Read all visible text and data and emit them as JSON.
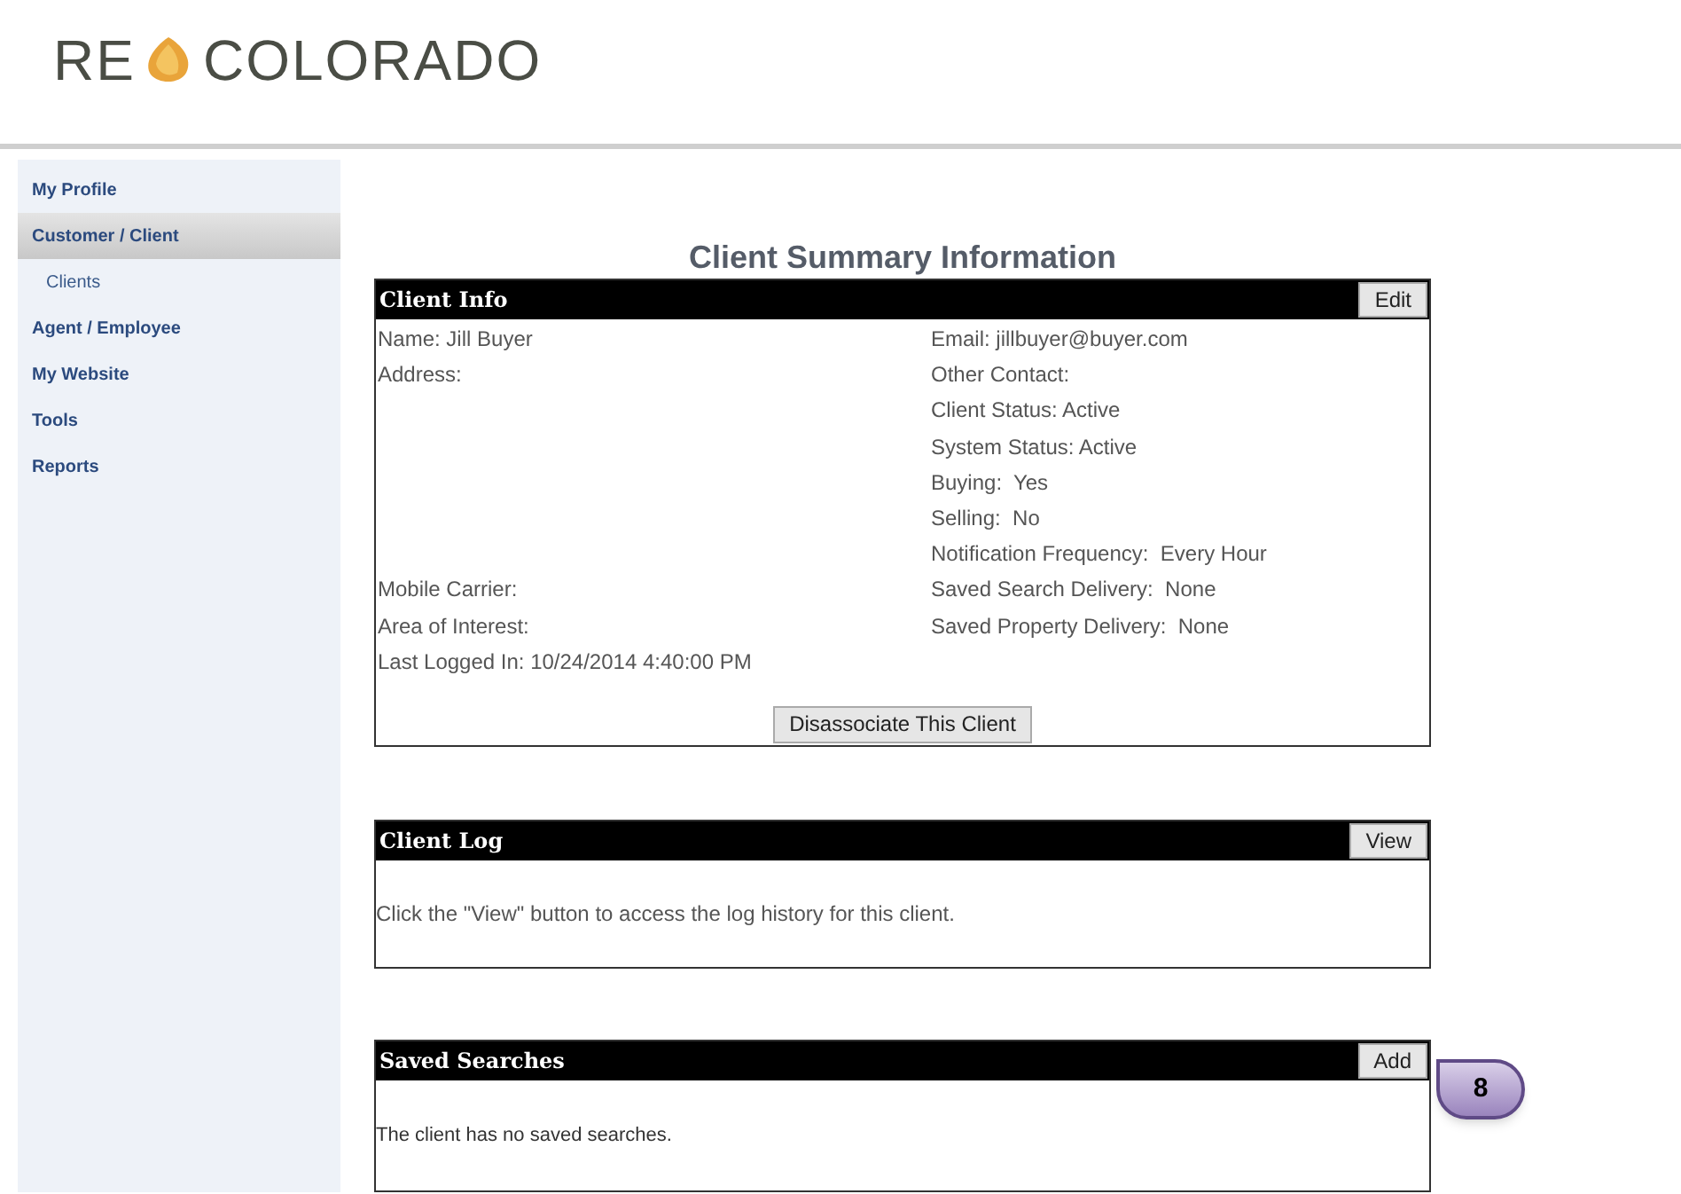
{
  "logo": {
    "left": "RE",
    "right": "COLORADO"
  },
  "sidebar": {
    "items": [
      {
        "label": "My Profile",
        "kind": "top",
        "selected": false
      },
      {
        "label": "Customer / Client",
        "kind": "top",
        "selected": true
      },
      {
        "label": "Clients",
        "kind": "sub",
        "selected": false
      },
      {
        "label": "Agent / Employee",
        "kind": "top",
        "selected": false
      },
      {
        "label": "My Website",
        "kind": "top",
        "selected": false
      },
      {
        "label": "Tools",
        "kind": "top",
        "selected": false
      },
      {
        "label": "Reports",
        "kind": "top",
        "selected": false
      }
    ]
  },
  "page_title": "Client Summary Information",
  "client_info": {
    "title": "Client Info",
    "button": "Edit",
    "rows": [
      {
        "left": "Name: Jill Buyer",
        "right": "Email: jillbuyer@buyer.com"
      },
      {
        "left": "Address:",
        "right": "Other Contact:"
      },
      {
        "right": "Client Status: Active"
      },
      {
        "right": "System Status: Active"
      },
      {
        "right": "Buying:  Yes"
      },
      {
        "right": "Selling:  No"
      },
      {
        "right": "Notification Frequency:  Every Hour"
      },
      {
        "left": "Mobile Carrier:",
        "right": "Saved Search Delivery:  None"
      },
      {
        "left": "Area of Interest:",
        "right": "Saved Property Delivery:  None"
      },
      {
        "left": "Last Logged In: 10/24/2014 4:40:00 PM"
      }
    ],
    "footer_button": "Disassociate This Client"
  },
  "client_log": {
    "title": "Client Log",
    "button": "View",
    "message": "Click the \"View\" button to access the log history for this client."
  },
  "saved_searches": {
    "title": "Saved Searches",
    "button": "Add",
    "message": "The client has no saved searches."
  },
  "callout": {
    "label": "8"
  }
}
